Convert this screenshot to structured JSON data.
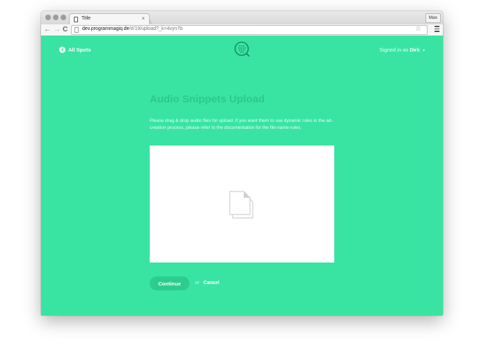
{
  "browser": {
    "tab_title": "Title",
    "tab_close": "×",
    "window_button": "Max",
    "url_host": "dev.programmagiq.de",
    "url_rest": "/#/19/upload?_k=4vyn7b"
  },
  "header": {
    "back_label": "All Spots",
    "signed_in_prefix": "Signed in as",
    "user": "Dirk",
    "caret": "▾"
  },
  "main": {
    "title": "Audio Snippets Upload",
    "description": "Please drag & drop audio files for upload. If you want them to use dynamic rules in the ad-creation process, please refer to the documentation for the file-name-rules.",
    "dropzone_icon": "document-icon"
  },
  "actions": {
    "continue_label": "Continue",
    "or_label": "or",
    "cancel_label": "Cancel"
  },
  "colors": {
    "page_bg": "#39e4a2",
    "title": "#2dc88a",
    "button": "#2ccc8c"
  }
}
